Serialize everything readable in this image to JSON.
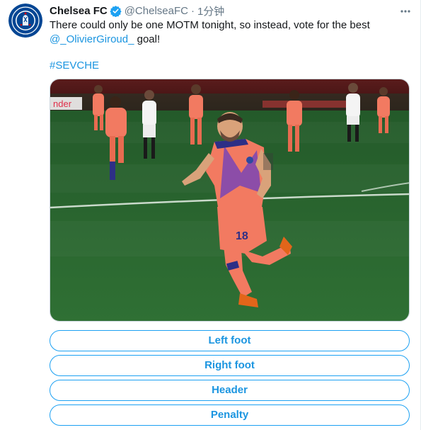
{
  "tweet": {
    "display_name": "Chelsea FC",
    "handle": "@ChelseaFC",
    "separator": "·",
    "timestamp": "1分钟",
    "text_line1": "There could only be one MOTM tonight, so instead, vote for the best",
    "mention": "@_OlivierGiroud_",
    "text_line2_rest": " goal!",
    "hashtag": "#SEVCHE",
    "media": {
      "player_number": "18",
      "ad_text": "nder"
    },
    "avatar_logo_text": "CHELSEA",
    "avatar_logo_subtext": "FOOTBALL CLUB",
    "icons": {
      "verified": "verified-badge-icon",
      "more": "more-options-icon"
    }
  },
  "poll": {
    "options": [
      "Left foot",
      "Right foot",
      "Header",
      "Penalty"
    ]
  },
  "colors": {
    "accent": "#1da1f2",
    "link": "#1b95e0",
    "chelsea_blue": "#034694",
    "kit": "#f27a61",
    "pitch": "#2f6a34"
  }
}
